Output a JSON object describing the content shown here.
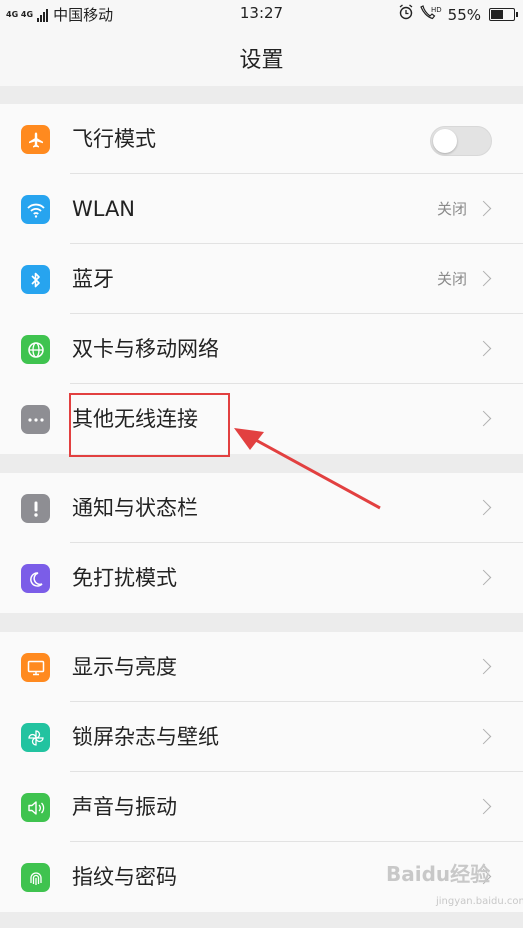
{
  "status_bar": {
    "network_type": "4G 4G",
    "carrier": "中国移动",
    "time": "13:27",
    "battery_percent": "55%",
    "battery_level": 0.55,
    "icons": [
      "alarm-icon",
      "hd-call-icon",
      "battery-icon"
    ]
  },
  "header": {
    "title": "设置"
  },
  "groups": [
    {
      "items": [
        {
          "label": "飞行模式",
          "icon": "airplane-icon",
          "icon_color": "#ff8a1f",
          "control": "toggle",
          "toggle_on": false
        },
        {
          "label": "WLAN",
          "icon": "wifi-icon",
          "icon_color": "#27a4ef",
          "value": "关闭"
        },
        {
          "label": "蓝牙",
          "icon": "bluetooth-icon",
          "icon_color": "#27a4ef",
          "value": "关闭"
        },
        {
          "label": "双卡与移动网络",
          "icon": "globe-icon",
          "icon_color": "#3fc34f"
        },
        {
          "label": "其他无线连接",
          "icon": "more-icon",
          "icon_color": "#8e8e93"
        }
      ]
    },
    {
      "items": [
        {
          "label": "通知与状态栏",
          "icon": "exclamation-icon",
          "icon_color": "#8e8e93"
        },
        {
          "label": "免打扰模式",
          "icon": "moon-icon",
          "icon_color": "#7b5de8"
        }
      ]
    },
    {
      "items": [
        {
          "label": "显示与亮度",
          "icon": "display-icon",
          "icon_color": "#ff8a1f"
        },
        {
          "label": "锁屏杂志与壁纸",
          "icon": "pinwheel-icon",
          "icon_color": "#22c3a0"
        },
        {
          "label": "声音与振动",
          "icon": "speaker-icon",
          "icon_color": "#3fc34f"
        },
        {
          "label": "指纹与密码",
          "icon": "fingerprint-icon",
          "icon_color": "#3fc34f"
        }
      ]
    }
  ],
  "watermark": {
    "text": "Baidu经验",
    "sub": "jingyan.baidu.com"
  }
}
